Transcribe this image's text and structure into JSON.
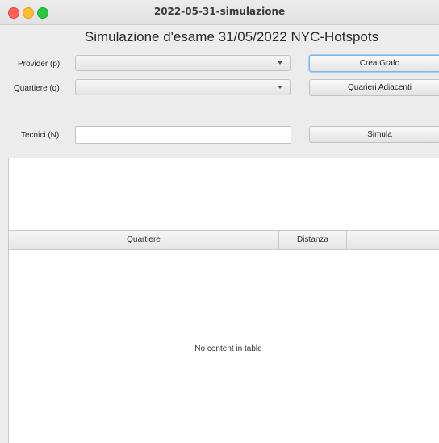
{
  "window": {
    "title": "2022-05-31-simulazione"
  },
  "app": {
    "title": "Simulazione d'esame 31/05/2022 NYC-Hotspots"
  },
  "form": {
    "provider_label": "Provider (p)",
    "quartiere_label": "Quartiere (q)",
    "tecnici_label": "Tecnici (N)",
    "provider_value": "",
    "quartiere_value": "",
    "tecnici_value": ""
  },
  "buttons": {
    "crea_grafo": "Crea Grafo",
    "quartieri_adiacenti": "Quarieri Adiacenti",
    "simula": "Simula"
  },
  "result": {
    "text": ""
  },
  "table": {
    "columns": [
      "Quartiere",
      "Distanza"
    ],
    "empty_text": "No content in table"
  }
}
